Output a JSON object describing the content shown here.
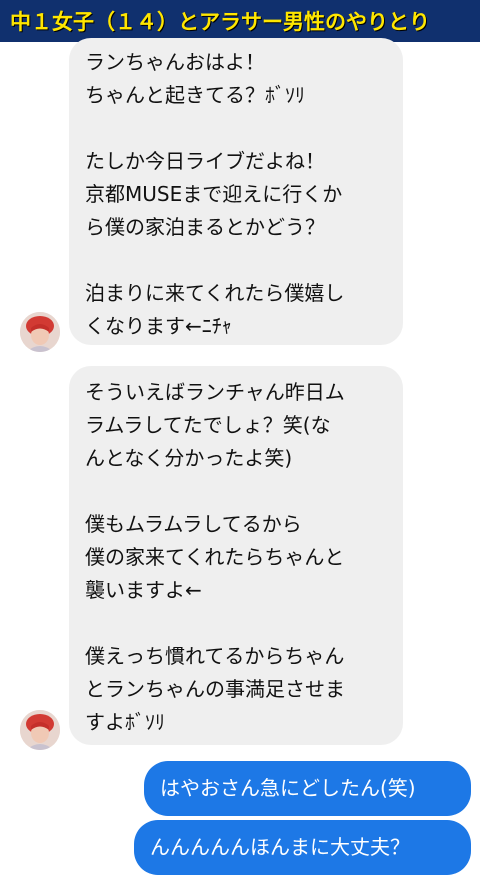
{
  "header": {
    "title": "中１女子（１４）とアラサー男性のやりとり"
  },
  "messages": [
    {
      "side": "incoming",
      "text": "ランちゃんおはよ！\nちゃんと起きてる？ﾎﾞｿﾘ\n\nたしか今日ライブだよね！\n京都MUSEまで迎えに行くか\nら僕の家泊まるとかどう？\n\n泊まりに来てくれたら僕嬉し\nくなります←ﾆﾁｬ"
    },
    {
      "side": "incoming",
      "text": "そういえばランチャん昨日ム\nラムラしてたでしょ？笑(な\nんとなく分かったよ笑)\n\n僕もムラムラしてるから\n僕の家来てくれたらちゃんと\n襲いますよ←\n\n僕えっち慣れてるからちゃん\nとランちゃんの事満足させま\nすよﾎﾞｿﾘ"
    },
    {
      "side": "outgoing",
      "text": "はやおさん急にどしたん(笑)"
    },
    {
      "side": "outgoing",
      "text": "んんんんんほんまに大丈夫？"
    }
  ],
  "colors": {
    "title_bg": "#10306e",
    "title_text": "#ffe600",
    "incoming_bubble": "#efefef",
    "outgoing_bubble": "#1d78e6"
  },
  "icons": {
    "avatar": "sender-profile-photo"
  }
}
